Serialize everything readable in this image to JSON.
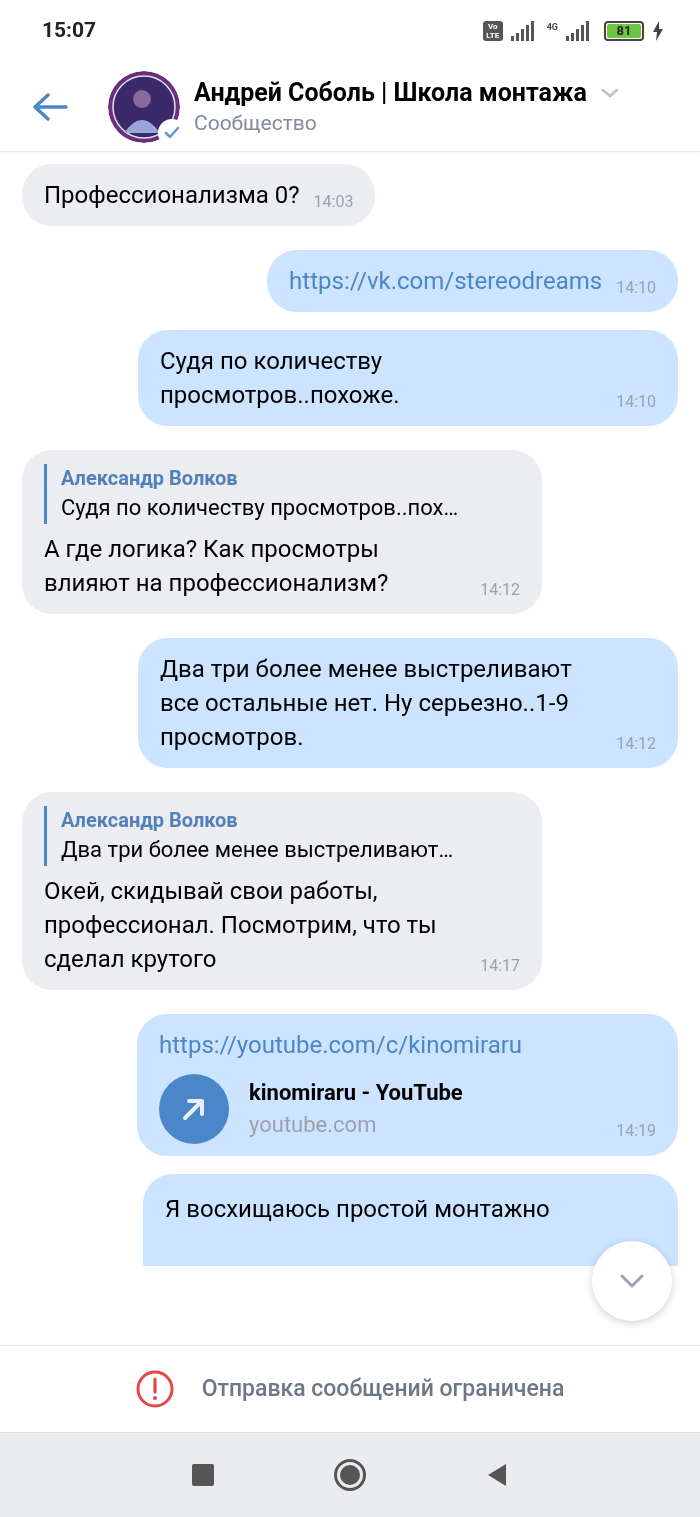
{
  "status_bar": {
    "time": "15:07",
    "network_badge": "Vo LTE",
    "network_type": "4G",
    "battery": "81"
  },
  "header": {
    "title": "Андрей Соболь | Школа монтажа",
    "subtitle": "Сообщество",
    "verified": true
  },
  "messages": [
    {
      "kind": "text",
      "outgoing": false,
      "text": "Профессионализма 0?",
      "time": "14:03"
    },
    {
      "kind": "link_text",
      "outgoing": true,
      "text": "https://vk.com/stereodreams",
      "time": "14:10"
    },
    {
      "kind": "text",
      "outgoing": true,
      "text": "Судя по количеству просмотров..похоже.",
      "time": "14:10"
    },
    {
      "kind": "reply",
      "outgoing": false,
      "reply_author": "Александр Волков",
      "reply_text": "Судя по количеству просмотров..пох…",
      "text": "А где логика? Как просмотры влияют на профессионализм?",
      "time": "14:12"
    },
    {
      "kind": "text",
      "outgoing": true,
      "text": "Два три более менее выстреливают все остальные нет. Ну серьезно..1-9 просмотров.",
      "time": "14:12"
    },
    {
      "kind": "reply",
      "outgoing": false,
      "reply_author": "Александр Волков",
      "reply_text": "Два три более менее выстреливают…",
      "text": "Окей, скидывай свои работы, профессионал. Посмотрим, что ты сделал крутого",
      "time": "14:17"
    },
    {
      "kind": "link",
      "outgoing": true,
      "text": "https://youtube.com/c/kinomiraru",
      "link_title": "kinomiraru - YouTube",
      "link_domain": "youtube.com",
      "time": "14:19"
    },
    {
      "kind": "partial",
      "outgoing": true,
      "text": "Я восхищаюсь простой монтажно"
    }
  ],
  "footer": {
    "notice": "Отправка сообщений ограничена"
  }
}
